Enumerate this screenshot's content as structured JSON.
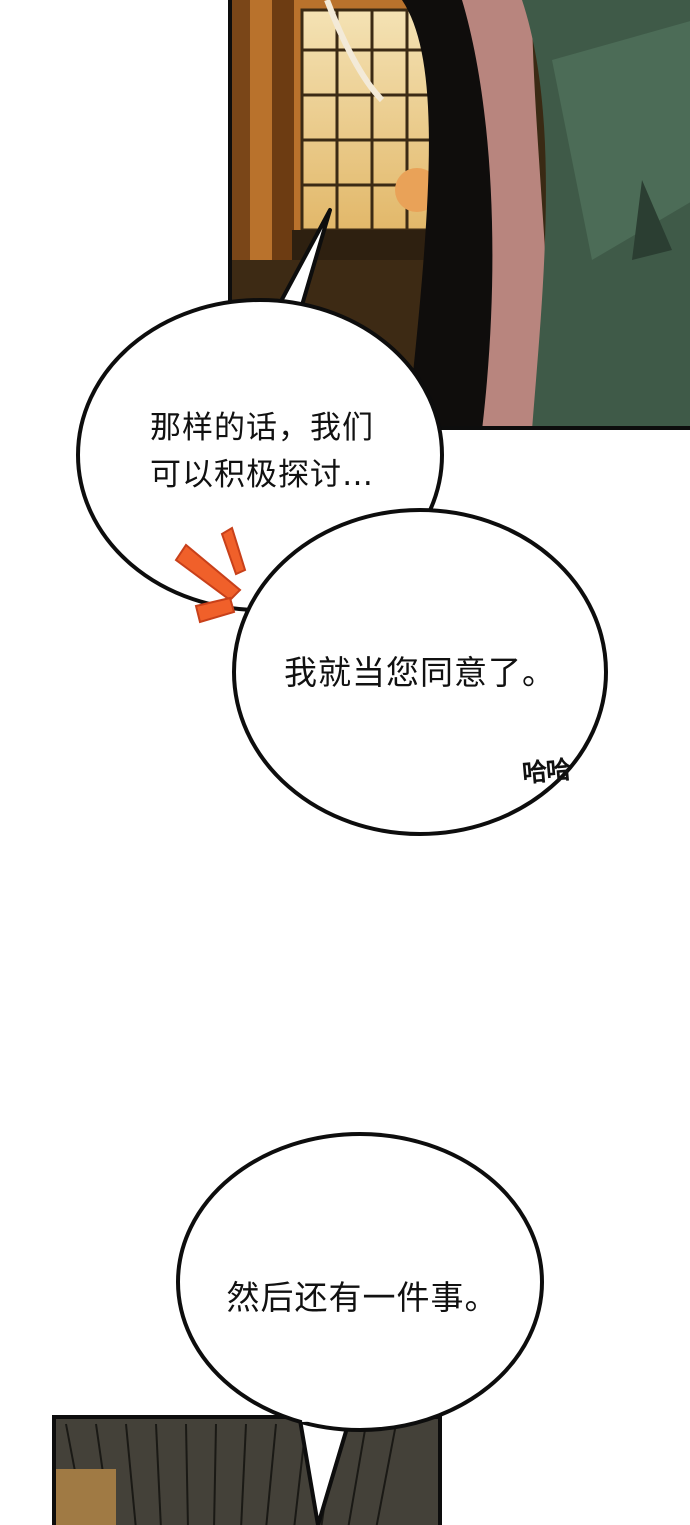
{
  "bubbles": {
    "first": {
      "line1": "那样的话，我们",
      "line2": "可以积极探讨…"
    },
    "second": {
      "text": "我就当您同意了。"
    },
    "third": {
      "text": "然后还有一件事。"
    }
  },
  "sfx": {
    "laugh": "哈哈"
  },
  "colors": {
    "accent": "#f0602a",
    "bubble_fill": "#ffffff",
    "outline": "#0d0d0d"
  }
}
